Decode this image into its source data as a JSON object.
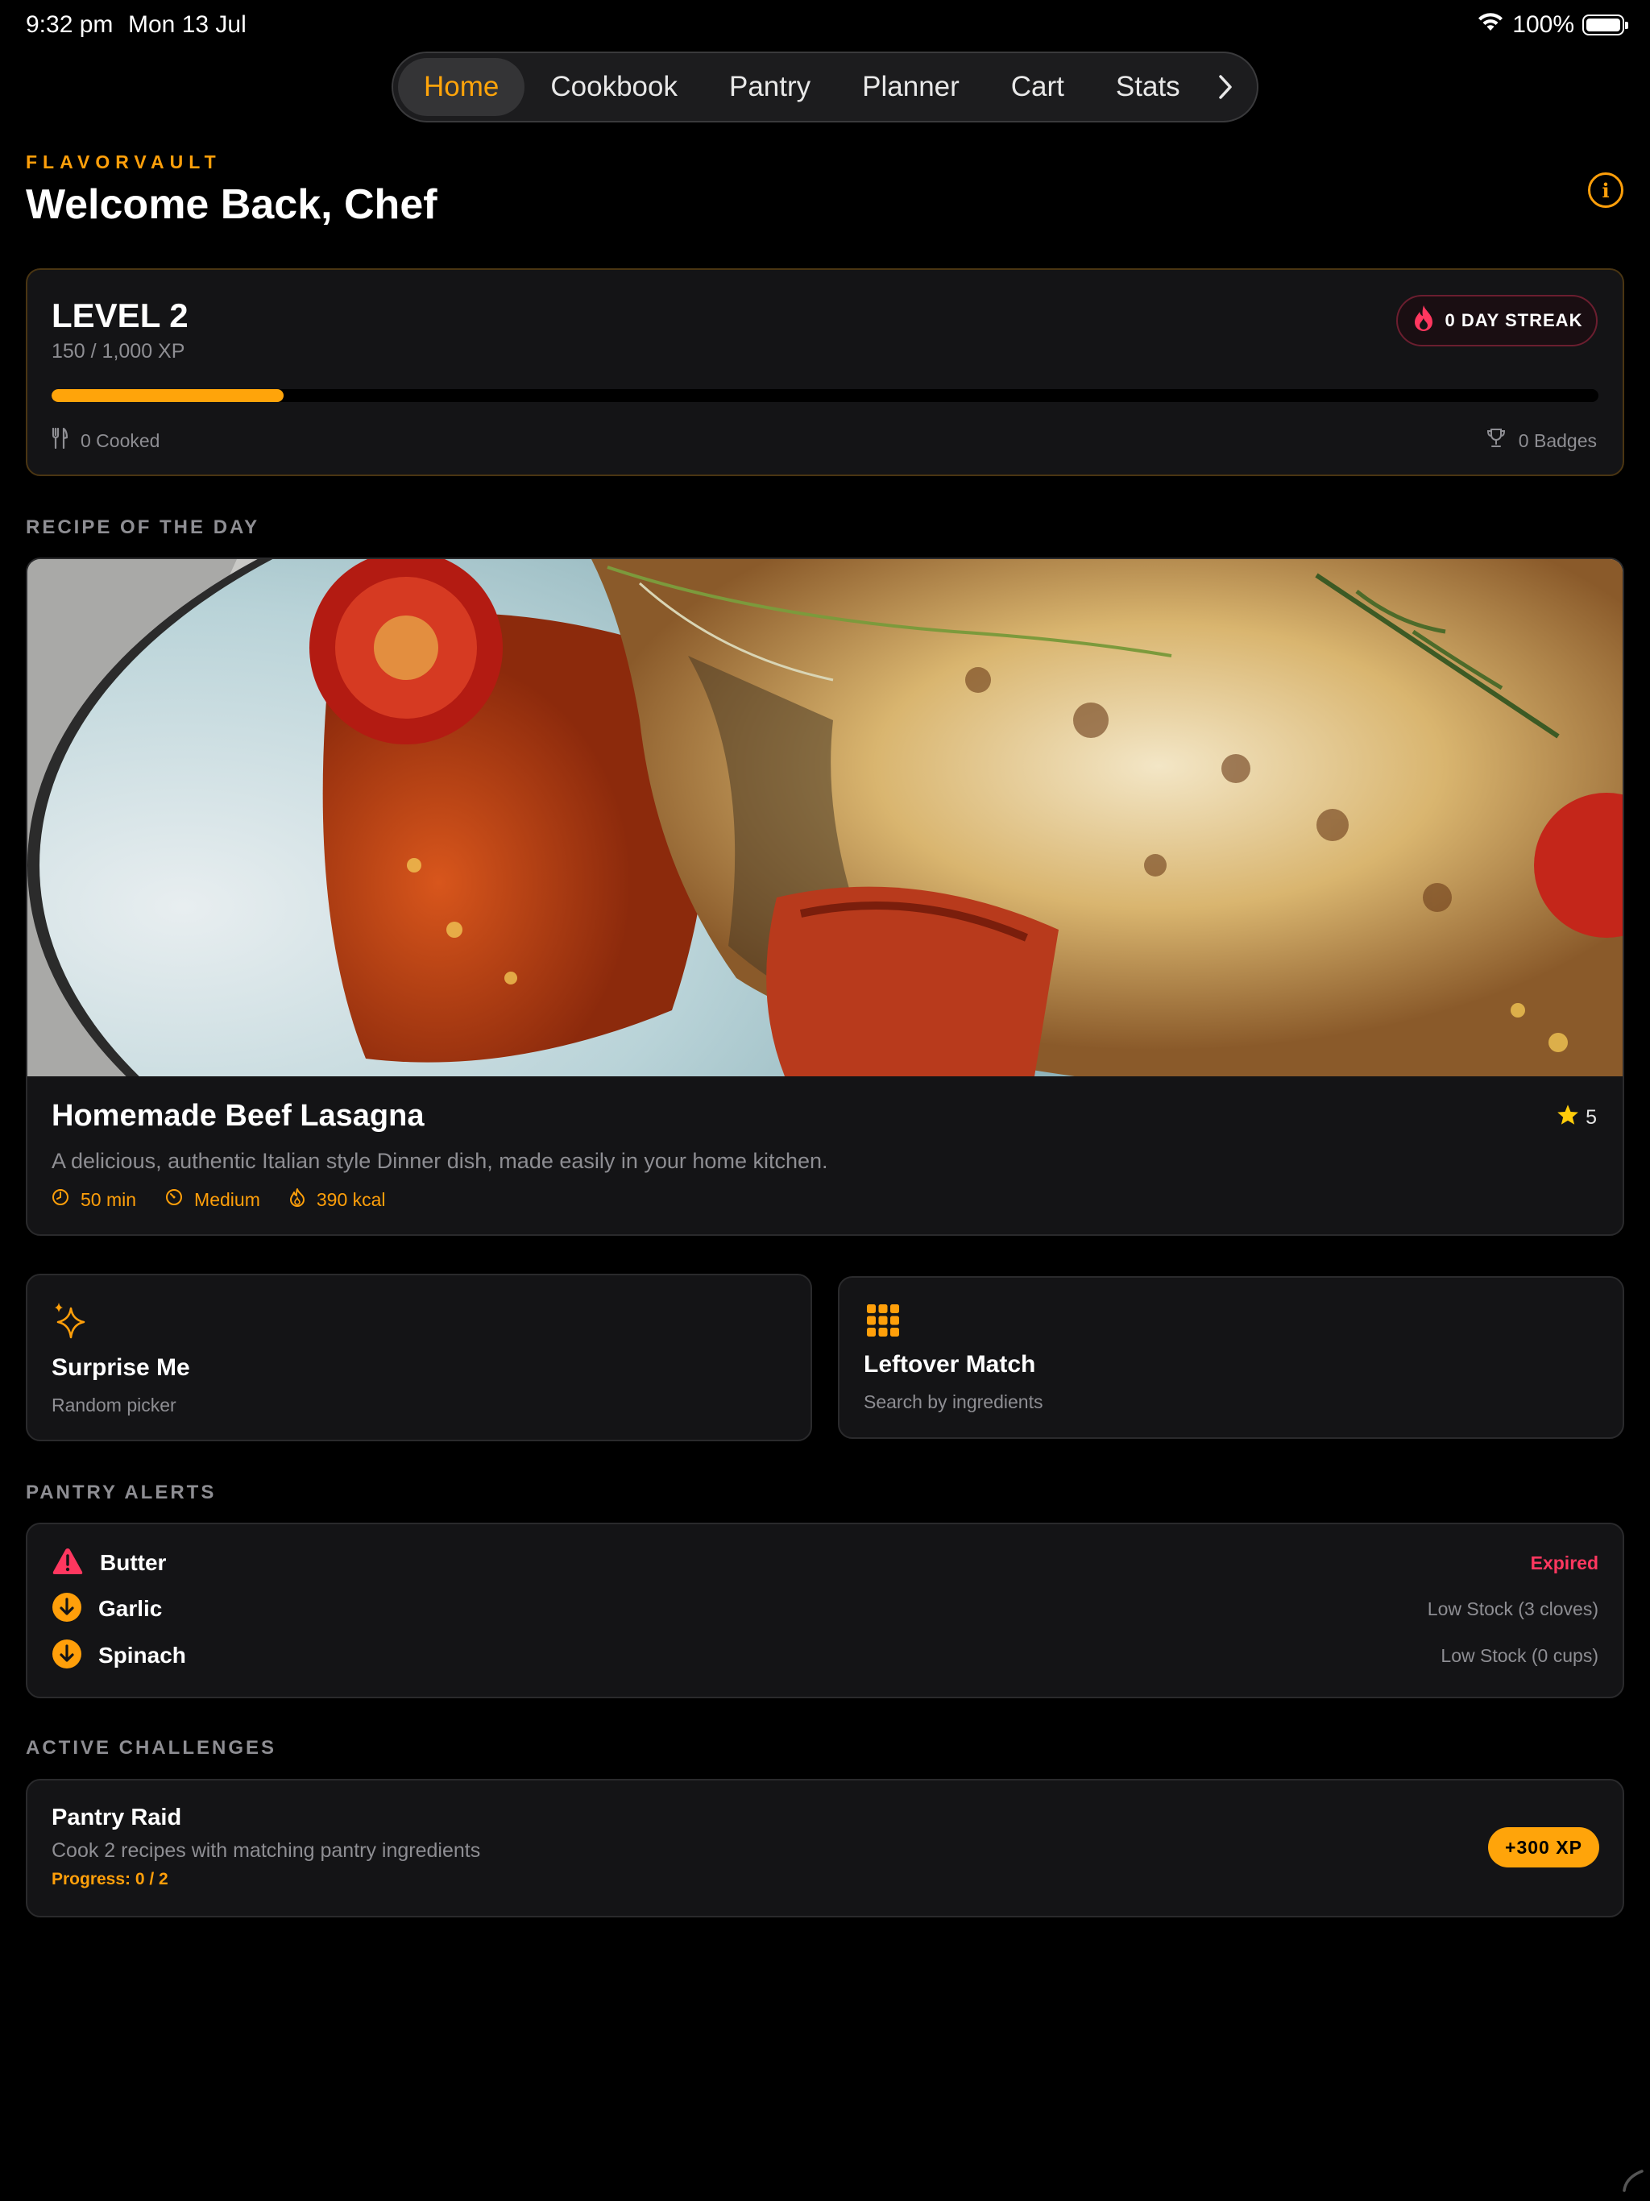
{
  "status_bar": {
    "time": "9:32 pm",
    "date": "Mon 13 Jul",
    "battery": "100%",
    "icons": [
      "wifi-icon",
      "battery-icon"
    ]
  },
  "nav": {
    "tabs": [
      {
        "label": "Home",
        "active": true
      },
      {
        "label": "Cookbook",
        "active": false
      },
      {
        "label": "Pantry",
        "active": false
      },
      {
        "label": "Planner",
        "active": false
      },
      {
        "label": "Cart",
        "active": false
      },
      {
        "label": "Stats",
        "active": false
      }
    ],
    "more_icon": "chevron-right-icon"
  },
  "header": {
    "brand": "FLAVORVAULT",
    "title": "Welcome Back, Chef",
    "info_icon": "info-icon"
  },
  "level": {
    "title": "LEVEL 2",
    "xp": "150 / 1,000 XP",
    "progress": 0.15,
    "streak": "0 DAY STREAK",
    "cooked": "0 Cooked",
    "badges": "0 Badges"
  },
  "recipe_of_day": {
    "section_label": "RECIPE OF THE DAY",
    "title": "Homemade Beef Lasagna",
    "rating": "5",
    "description": "A delicious, authentic Italian style Dinner dish, made easily in your home kitchen.",
    "time": "50 min",
    "difficulty": "Medium",
    "calories": "390 kcal"
  },
  "actions": {
    "surprise": {
      "title": "Surprise Me",
      "subtitle": "Random picker"
    },
    "leftover": {
      "title": "Leftover Match",
      "subtitle": "Search by ingredients"
    }
  },
  "pantry_alerts": {
    "section_label": "PANTRY ALERTS",
    "items": [
      {
        "name": "Butter",
        "status": "Expired",
        "icon": "warning-triangle-icon"
      },
      {
        "name": "Garlic",
        "status": "Low Stock (3 cloves)",
        "icon": "arrow-down-circle-icon"
      },
      {
        "name": "Spinach",
        "status": "Low Stock (0 cups)",
        "icon": "arrow-down-circle-icon"
      }
    ]
  },
  "challenges": {
    "section_label": "ACTIVE CHALLENGES",
    "items": [
      {
        "title": "Pantry Raid",
        "description": "Cook 2 recipes with matching pantry ingredients",
        "progress": "Progress: 0 / 2",
        "reward": "+300 XP"
      }
    ]
  },
  "colors": {
    "accent": "#ff9f0a",
    "danger": "#ff375f",
    "background": "#000000",
    "card": "#141416"
  }
}
